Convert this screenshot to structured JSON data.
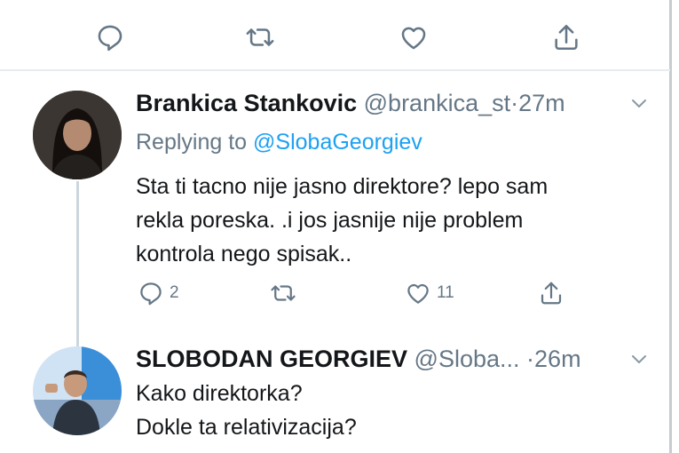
{
  "top_bar": {
    "actions": [
      "reply-icon",
      "retweet-icon",
      "like-icon",
      "share-icon"
    ]
  },
  "tweets": [
    {
      "name": "Brankica Stankovic",
      "handle": "@brankica_st",
      "separator": "·",
      "time": "27m",
      "replying_label": "Replying to",
      "replying_to": "@SlobaGeorgiev",
      "body": [
        "Sta ti tacno nije jasno direktore? lepo sam",
        "rekla poreska. .i jos jasnije nije problem",
        "kontrola nego spisak.."
      ],
      "replies": "2",
      "retweets": "",
      "likes": "11"
    },
    {
      "name": "SLOBODAN GEORGIEV",
      "handle": "@Sloba...",
      "separator": "·",
      "time": "26m",
      "body": [
        "Kako direktorka?",
        "Dokle ta relativizacija?"
      ]
    }
  ],
  "colors": {
    "text": "#14171a",
    "muted": "#657786",
    "link": "#1da1f2",
    "divider": "#e6ecf0",
    "thread": "#ccd6dd"
  }
}
